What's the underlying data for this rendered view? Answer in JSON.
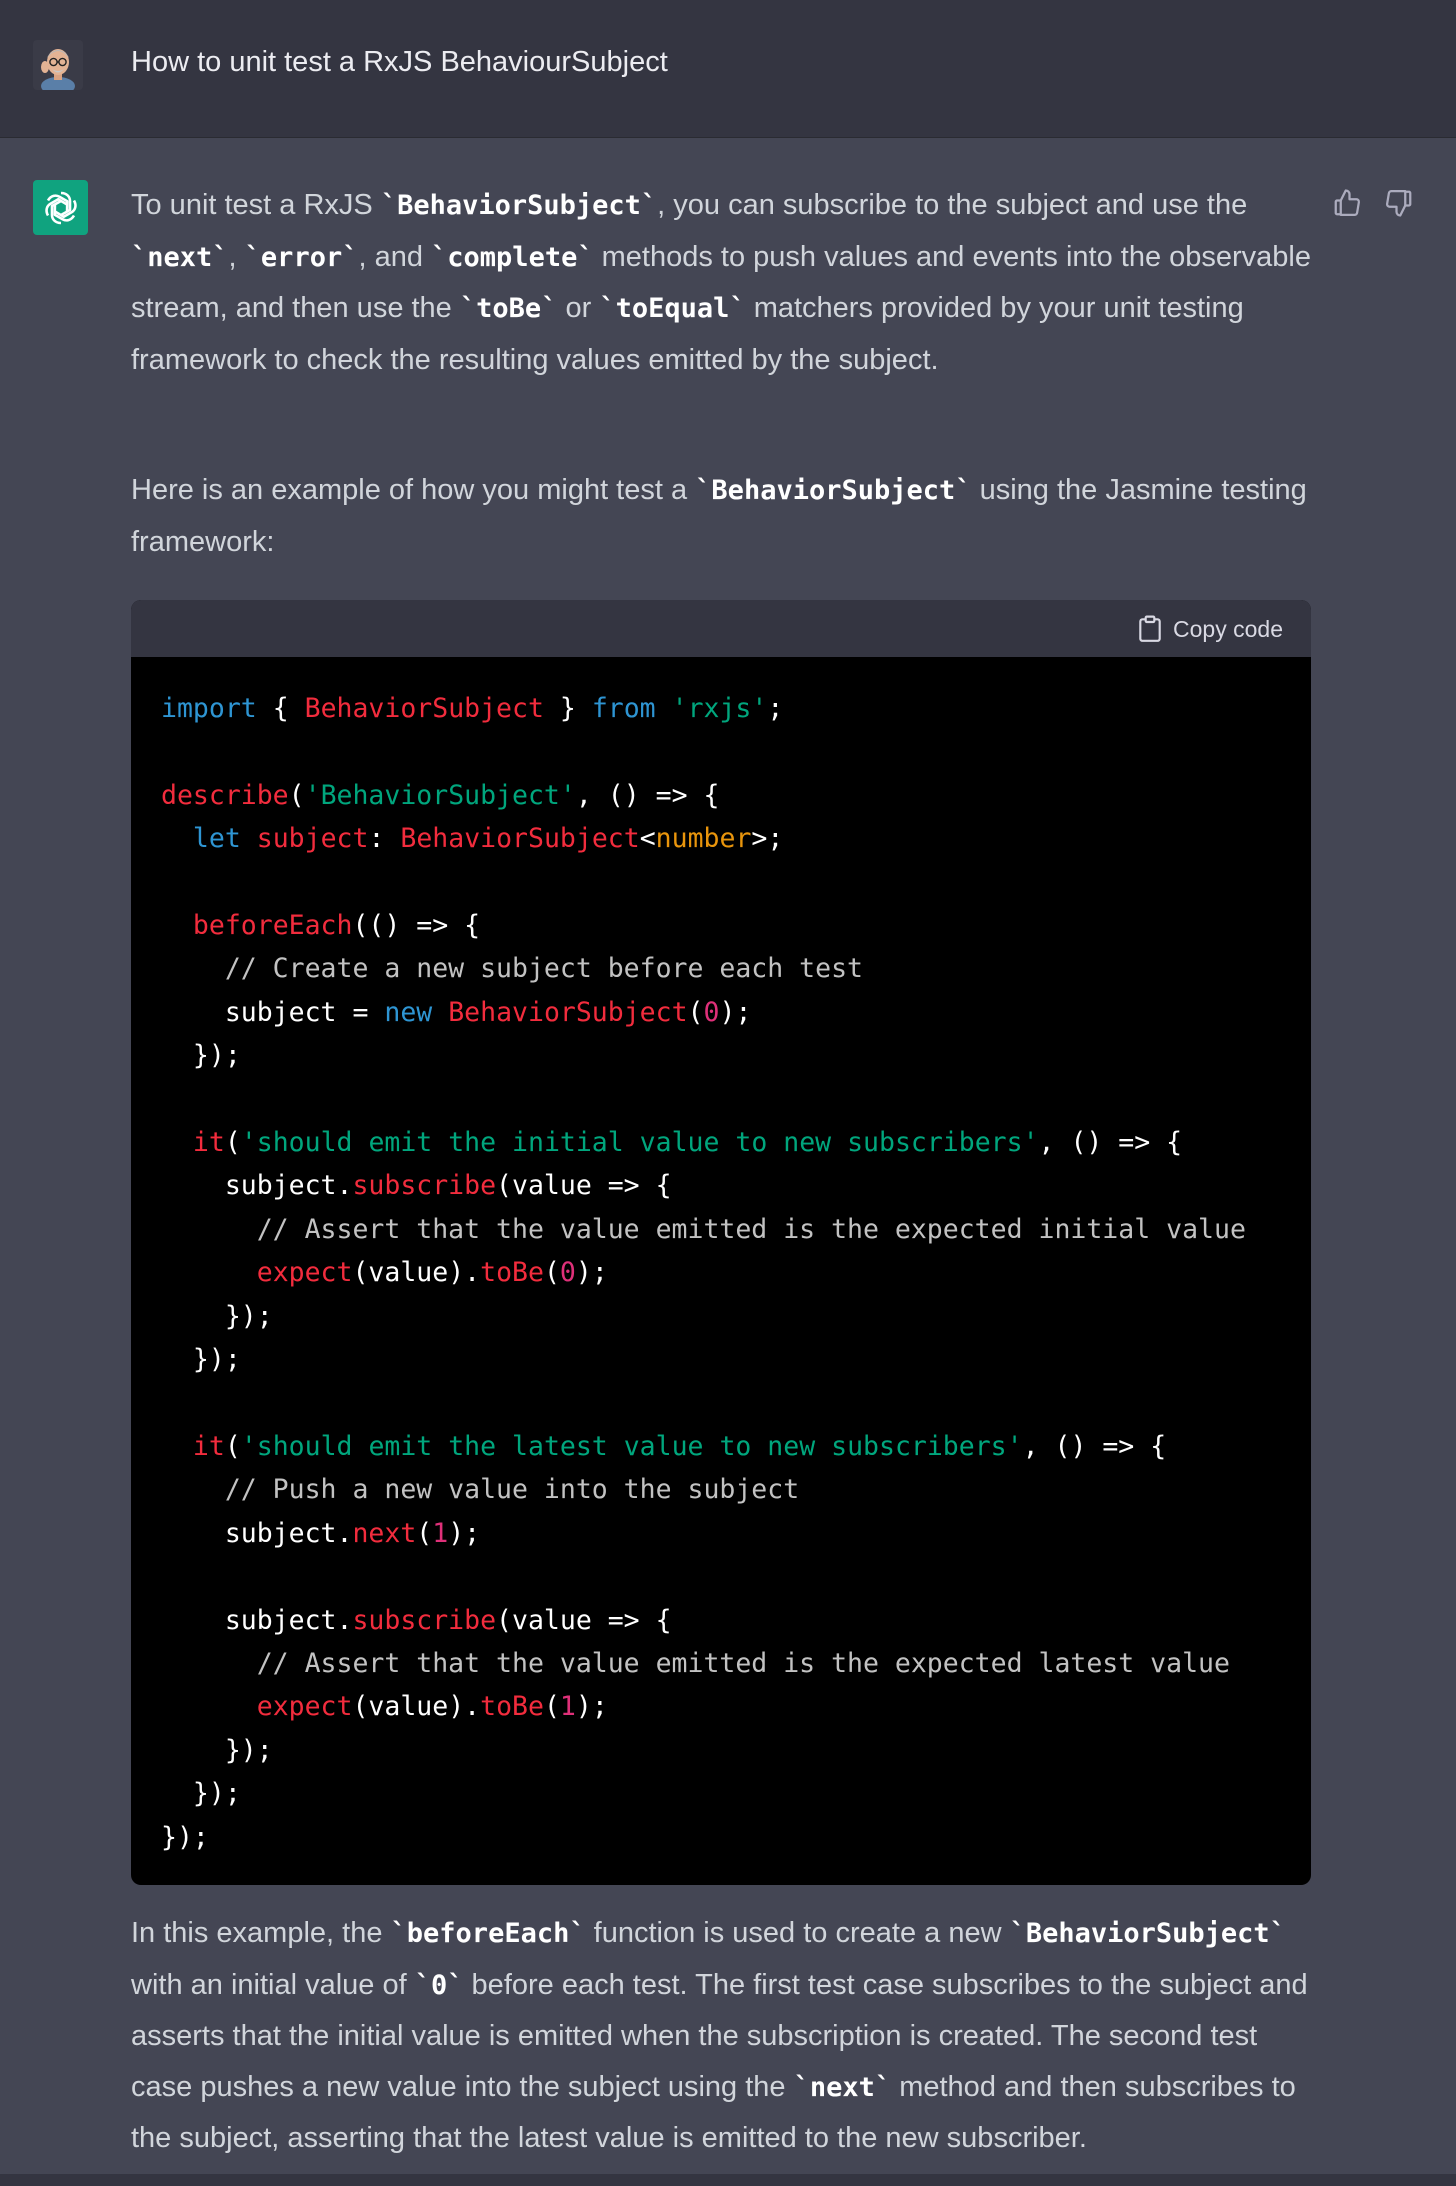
{
  "user_message": {
    "text": "How to unit test a RxJS BehaviourSubject",
    "avatar": "memoji-avatar"
  },
  "assistant": {
    "logo": "openai-logo-icon",
    "brand_color": "#10a37f",
    "paragraph1": [
      {
        "t": "To unit test a RxJS "
      },
      {
        "c": "`BehaviorSubject`"
      },
      {
        "t": ", you can subscribe to the subject and use the "
      },
      {
        "c": "`next`"
      },
      {
        "t": ", "
      },
      {
        "c": "`error`"
      },
      {
        "t": ", and "
      },
      {
        "c": "`complete`"
      },
      {
        "t": " methods to push values and events into the observable stream, and then use the "
      },
      {
        "c": "`toBe`"
      },
      {
        "t": " or "
      },
      {
        "c": "`toEqual`"
      },
      {
        "t": " matchers provided by your unit testing framework to check the resulting values emitted by the subject."
      }
    ],
    "paragraph2": [
      {
        "t": "Here is an example of how you might test a "
      },
      {
        "c": "`BehaviorSubject`"
      },
      {
        "t": " using the Jasmine testing framework:"
      }
    ],
    "code_block": {
      "copy_label": "Copy code",
      "lines": [
        [
          [
            "kw",
            "import"
          ],
          [
            "p",
            " { "
          ],
          [
            "fn",
            "BehaviorSubject"
          ],
          [
            "p",
            " } "
          ],
          [
            "kw",
            "from"
          ],
          [
            "p",
            " "
          ],
          [
            "str",
            "'rxjs'"
          ],
          [
            "p",
            ";"
          ]
        ],
        [],
        [
          [
            "fn",
            "describe"
          ],
          [
            "p",
            "("
          ],
          [
            "str",
            "'BehaviorSubject'"
          ],
          [
            "p",
            ", () => {"
          ]
        ],
        [
          [
            "p",
            "  "
          ],
          [
            "kw",
            "let"
          ],
          [
            "p",
            " "
          ],
          [
            "fn",
            "subject"
          ],
          [
            "p",
            ": "
          ],
          [
            "fn",
            "BehaviorSubject"
          ],
          [
            "p",
            "<"
          ],
          [
            "ty",
            "number"
          ],
          [
            "p",
            ">;"
          ]
        ],
        [],
        [
          [
            "p",
            "  "
          ],
          [
            "fn",
            "beforeEach"
          ],
          [
            "p",
            "(() => {"
          ]
        ],
        [
          [
            "cm",
            "    // Create a new subject before each test"
          ]
        ],
        [
          [
            "p",
            "    subject = "
          ],
          [
            "kw",
            "new"
          ],
          [
            "p",
            " "
          ],
          [
            "fn",
            "BehaviorSubject"
          ],
          [
            "p",
            "("
          ],
          [
            "num",
            "0"
          ],
          [
            "p",
            ");"
          ]
        ],
        [
          [
            "p",
            "  });"
          ]
        ],
        [],
        [
          [
            "p",
            "  "
          ],
          [
            "fn",
            "it"
          ],
          [
            "p",
            "("
          ],
          [
            "str",
            "'should emit the initial value to new subscribers'"
          ],
          [
            "p",
            ", () => {"
          ]
        ],
        [
          [
            "p",
            "    subject."
          ],
          [
            "fn",
            "subscribe"
          ],
          [
            "p",
            "(value => {"
          ]
        ],
        [
          [
            "cm",
            "      // Assert that the value emitted is the expected initial value"
          ]
        ],
        [
          [
            "p",
            "      "
          ],
          [
            "fn",
            "expect"
          ],
          [
            "p",
            "(value)."
          ],
          [
            "fn",
            "toBe"
          ],
          [
            "p",
            "("
          ],
          [
            "num",
            "0"
          ],
          [
            "p",
            ");"
          ]
        ],
        [
          [
            "p",
            "    });"
          ]
        ],
        [
          [
            "p",
            "  });"
          ]
        ],
        [],
        [
          [
            "p",
            "  "
          ],
          [
            "fn",
            "it"
          ],
          [
            "p",
            "("
          ],
          [
            "str",
            "'should emit the latest value to new subscribers'"
          ],
          [
            "p",
            ", () => {"
          ]
        ],
        [
          [
            "cm",
            "    // Push a new value into the subject"
          ]
        ],
        [
          [
            "p",
            "    subject."
          ],
          [
            "fn",
            "next"
          ],
          [
            "p",
            "("
          ],
          [
            "num",
            "1"
          ],
          [
            "p",
            ");"
          ]
        ],
        [],
        [
          [
            "p",
            "    subject."
          ],
          [
            "fn",
            "subscribe"
          ],
          [
            "p",
            "(value => {"
          ]
        ],
        [
          [
            "cm",
            "      // Assert that the value emitted is the expected latest value"
          ]
        ],
        [
          [
            "p",
            "      "
          ],
          [
            "fn",
            "expect"
          ],
          [
            "p",
            "(value)."
          ],
          [
            "fn",
            "toBe"
          ],
          [
            "p",
            "("
          ],
          [
            "num",
            "1"
          ],
          [
            "p",
            ");"
          ]
        ],
        [
          [
            "p",
            "    });"
          ]
        ],
        [
          [
            "p",
            "  });"
          ]
        ],
        [
          [
            "p",
            "});"
          ]
        ]
      ]
    },
    "paragraph3": [
      {
        "t": "In this example, the "
      },
      {
        "c": "`beforeEach`"
      },
      {
        "t": " function is used to create a new "
      },
      {
        "c": "`BehaviorSubject`"
      },
      {
        "t": " with an initial value of "
      },
      {
        "c": "`0`"
      },
      {
        "t": " before each test. The first test case subscribes to the subject and asserts that the initial value is emitted when the subscription is created. The second test case pushes a new value into the subject using the "
      },
      {
        "c": "`next`"
      },
      {
        "t": " method and then subscribes to the subject, asserting that the latest value is emitted to the new subscriber."
      }
    ],
    "feedback": {
      "like_icon": "thumbs-up-icon",
      "dislike_icon": "thumbs-down-icon"
    }
  }
}
